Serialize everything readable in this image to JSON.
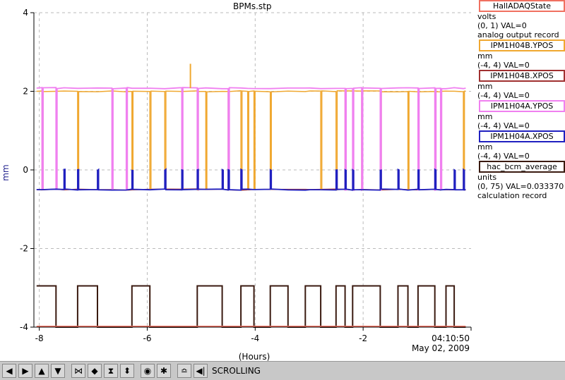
{
  "chart_data": {
    "type": "line",
    "title": "BPMs.stp",
    "xlabel": "(Hours)",
    "ylabel": "mm",
    "xlim": [
      -8.1,
      0
    ],
    "ylim": [
      -4,
      4
    ],
    "x_ticks": [
      "-8",
      "-6",
      "-4",
      "-2"
    ],
    "y_ticks": [
      "4",
      "2",
      "0",
      "-2",
      "-4"
    ],
    "end_time": "04:10:50",
    "end_date": "May 02, 2009",
    "grid": true,
    "series": [
      {
        "name": "HallADAQState",
        "color": "#f07060",
        "values_summary": [
          -4,
          -4
        ]
      },
      {
        "name": "IPM1H04B.YPOS",
        "color": "#f0a830",
        "baseline": 2.0,
        "dropout_level": -0.5
      },
      {
        "name": "IPM1H04B.XPOS",
        "color": "#a03030",
        "baseline": -0.5
      },
      {
        "name": "IPM1H04A.YPOS",
        "color": "#f080f0",
        "baseline": 2.08,
        "dropout_level": -0.5,
        "spike": {
          "x": -5.2,
          "y": 2.7
        }
      },
      {
        "name": "IPM1H04A.XPOS",
        "color": "#2020c0",
        "baseline": -0.5,
        "dropout_level": 0.0
      },
      {
        "name": "hac_bcm_average",
        "color": "#3a1a10",
        "levels": [
          -2.95,
          -4.0
        ]
      }
    ]
  },
  "legend": [
    {
      "name": "HallADAQState",
      "color": "#f07060",
      "lines": [
        "volts",
        "(0, 1) VAL=0",
        "analog output record"
      ]
    },
    {
      "name": "IPM1H04B.YPOS",
      "color": "#f0a830",
      "lines": [
        "mm",
        "(-4, 4) VAL=0"
      ]
    },
    {
      "name": "IPM1H04B.XPOS",
      "color": "#a03030",
      "lines": [
        "mm",
        "(-4, 4) VAL=0"
      ]
    },
    {
      "name": "IPM1H04A.YPOS",
      "color": "#f080f0",
      "lines": [
        "mm",
        "(-4, 4) VAL=0"
      ]
    },
    {
      "name": "IPM1H04A.XPOS",
      "color": "#2020c0",
      "lines": [
        "mm",
        "(-4, 4) VAL=0"
      ]
    },
    {
      "name": "hac_bcm_average",
      "color": "#3a1a10",
      "lines": [
        "units",
        "(0, 75) VAL=0.033370",
        "calculation record"
      ]
    }
  ],
  "toolbar": {
    "buttons": [
      "arrow-left-icon",
      "arrow-right-icon",
      "arrow-up-icon",
      "arrow-down-icon",
      "zoom-x-in-icon",
      "zoom-x-out-icon",
      "zoom-y-in-icon",
      "zoom-y-out-icon",
      "reset-icon",
      "config-icon",
      "fit-icon",
      "end-icon"
    ],
    "status": "SCROLLING"
  }
}
